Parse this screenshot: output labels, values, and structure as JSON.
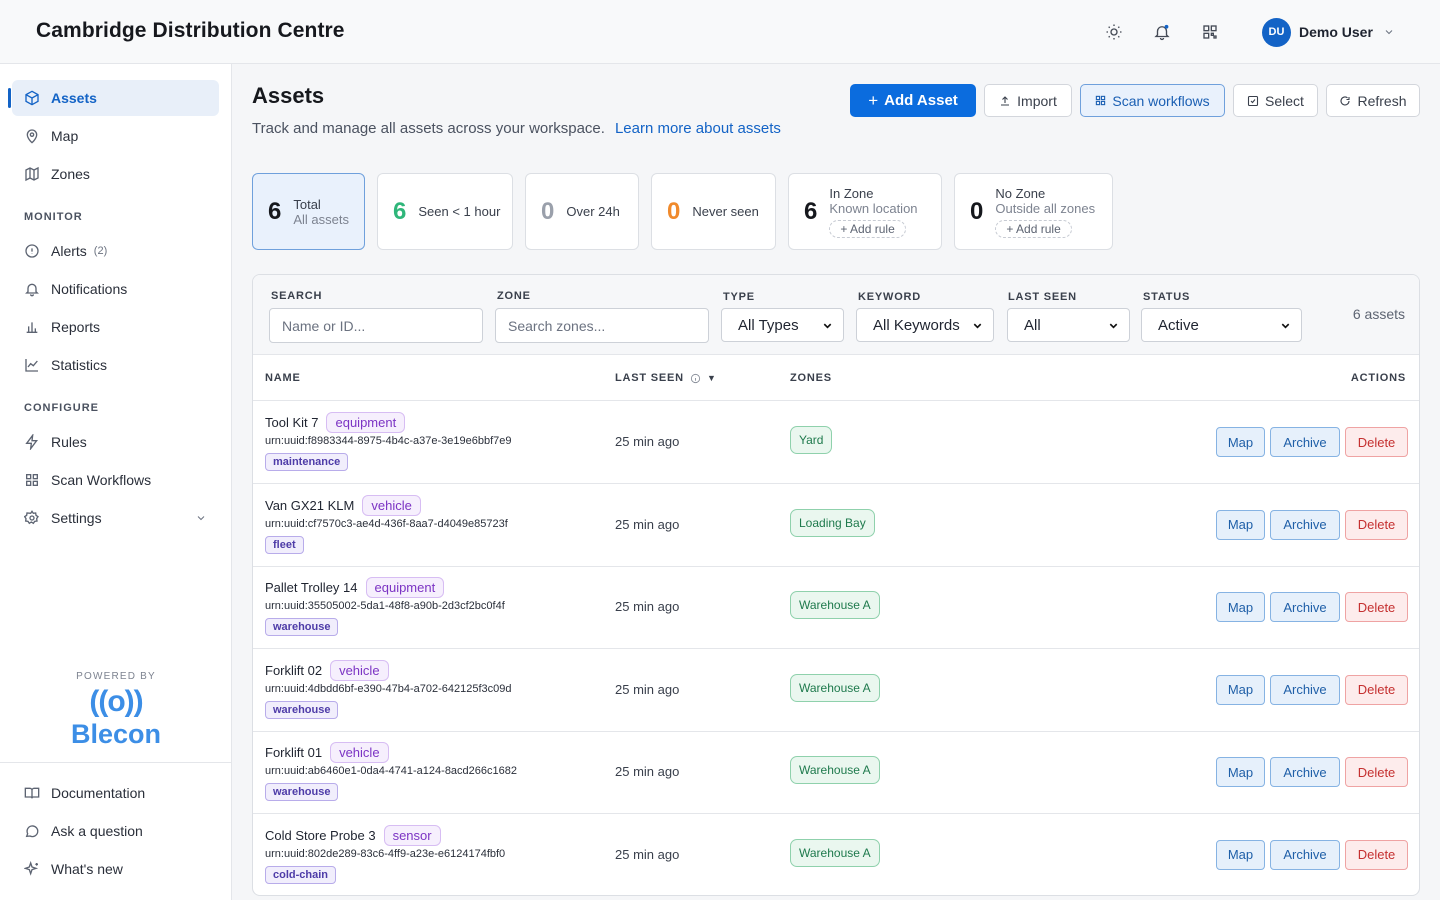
{
  "header": {
    "title": "Cambridge Distribution Centre",
    "user": {
      "initials": "DU",
      "name": "Demo User"
    },
    "icons": [
      "sun-icon",
      "bell-icon",
      "qr-grid-icon",
      "chevron-down-icon"
    ]
  },
  "sidebar": {
    "top_items": [
      {
        "label": "Assets",
        "icon": "cube-icon",
        "active": true
      },
      {
        "label": "Map",
        "icon": "map-pin-icon"
      },
      {
        "label": "Zones",
        "icon": "map-icon"
      }
    ],
    "monitor_label": "MONITOR",
    "monitor_items": [
      {
        "label": "Alerts",
        "icon": "alert-circle-icon",
        "count": "(2)"
      },
      {
        "label": "Notifications",
        "icon": "bell-icon"
      },
      {
        "label": "Reports",
        "icon": "bar-chart-icon"
      },
      {
        "label": "Statistics",
        "icon": "line-chart-icon"
      }
    ],
    "configure_label": "CONFIGURE",
    "configure_items": [
      {
        "label": "Rules",
        "icon": "bolt-icon"
      },
      {
        "label": "Scan Workflows",
        "icon": "grid-icon"
      },
      {
        "label": "Settings",
        "icon": "gear-icon"
      }
    ],
    "powered_by": "POWERED BY",
    "brand_glyph": "((o))",
    "brand_name": "Blecon",
    "footer_items": [
      {
        "label": "Documentation",
        "icon": "book-icon"
      },
      {
        "label": "Ask a question",
        "icon": "chat-icon"
      },
      {
        "label": "What's new",
        "icon": "sparkle-icon"
      }
    ]
  },
  "page": {
    "title": "Assets",
    "subtitle": "Track and manage all assets across your workspace.",
    "learn_more": "Learn more about assets",
    "buttons": {
      "add": "Add Asset",
      "import": "Import",
      "scan": "Scan workflows",
      "select": "Select",
      "refresh": "Refresh"
    }
  },
  "stats": [
    {
      "num": "6",
      "l1": "Total",
      "l2": "All assets",
      "color": "#16181d"
    },
    {
      "num": "6",
      "l1": "Seen < 1 hour",
      "color": "#2fb67a"
    },
    {
      "num": "0",
      "l1": "Over 24h",
      "color": "#9aa0ab"
    },
    {
      "num": "0",
      "l1": "Never seen",
      "color": "#f08a2c"
    },
    {
      "num": "6",
      "l1": "In Zone",
      "l2": "Known location",
      "rule": "Add rule",
      "color": "#16181d"
    },
    {
      "num": "0",
      "l1": "No Zone",
      "l2": "Outside all zones",
      "rule": "Add rule",
      "color": "#16181d"
    }
  ],
  "filters": {
    "search_label": "SEARCH",
    "search_placeholder": "Name or ID...",
    "zone_label": "ZONE",
    "zone_placeholder": "Search zones...",
    "type_label": "TYPE",
    "type_value": "All Types",
    "keyword_label": "KEYWORD",
    "keyword_value": "All Keywords",
    "last_seen_label": "LAST SEEN",
    "last_seen_value": "All",
    "status_label": "STATUS",
    "status_value": "Active",
    "count": "6 assets"
  },
  "table": {
    "headers": {
      "name": "NAME",
      "last_seen": "LAST SEEN",
      "zones": "ZONES",
      "actions": "ACTIONS"
    },
    "actions": {
      "map": "Map",
      "archive": "Archive",
      "delete": "Delete"
    },
    "rows": [
      {
        "name": "Tool Kit 7",
        "type": "equipment",
        "urn": "urn:uuid:f8983344-8975-4b4c-a37e-3e19e6bbf7e9",
        "keyword": "maintenance",
        "seen": "25 min ago",
        "zone": "Yard"
      },
      {
        "name": "Van GX21 KLM",
        "type": "vehicle",
        "urn": "urn:uuid:cf7570c3-ae4d-436f-8aa7-d4049e85723f",
        "keyword": "fleet",
        "seen": "25 min ago",
        "zone": "Loading Bay"
      },
      {
        "name": "Pallet Trolley 14",
        "type": "equipment",
        "urn": "urn:uuid:35505002-5da1-48f8-a90b-2d3cf2bc0f4f",
        "keyword": "warehouse",
        "seen": "25 min ago",
        "zone": "Warehouse A"
      },
      {
        "name": "Forklift 02",
        "type": "vehicle",
        "urn": "urn:uuid:4dbdd6bf-e390-47b4-a702-642125f3c09d",
        "keyword": "warehouse",
        "seen": "25 min ago",
        "zone": "Warehouse A"
      },
      {
        "name": "Forklift 01",
        "type": "vehicle",
        "urn": "urn:uuid:ab6460e1-0da4-4741-a124-8acd266c1682",
        "keyword": "warehouse",
        "seen": "25 min ago",
        "zone": "Warehouse A"
      },
      {
        "name": "Cold Store Probe 3",
        "type": "sensor",
        "urn": "urn:uuid:802de289-83c6-4ff9-a23e-e6124174fbf0",
        "keyword": "cold-chain",
        "seen": "25 min ago",
        "zone": "Warehouse A"
      }
    ]
  }
}
